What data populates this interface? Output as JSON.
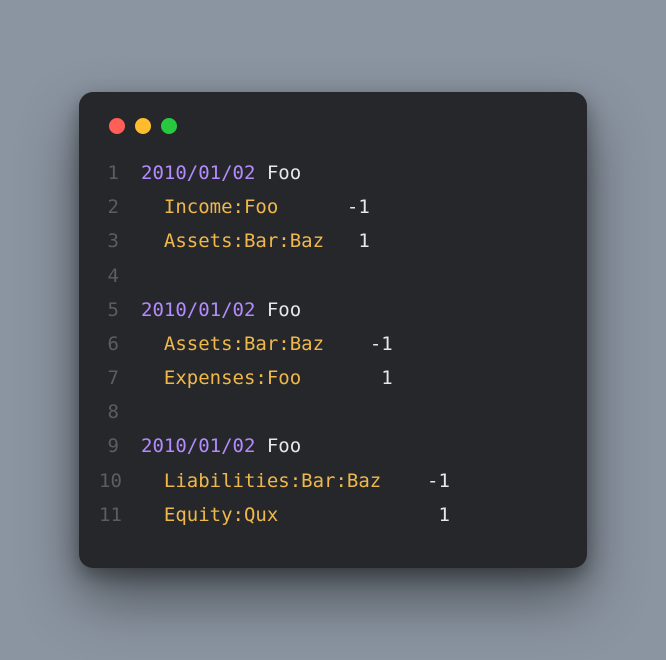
{
  "window": {
    "dots": [
      "red",
      "yellow",
      "green"
    ]
  },
  "lines": [
    {
      "n": "1",
      "type": "header",
      "date": "2010/01/02",
      "desc": "Foo"
    },
    {
      "n": "2",
      "type": "posting",
      "indent": "  ",
      "account": "Income:Foo",
      "spacer": "      ",
      "amount": "-1"
    },
    {
      "n": "3",
      "type": "posting",
      "indent": "  ",
      "account": "Assets:Bar:Baz",
      "spacer": "   ",
      "amount": "1"
    },
    {
      "n": "4",
      "type": "blank"
    },
    {
      "n": "5",
      "type": "header",
      "date": "2010/01/02",
      "desc": "Foo"
    },
    {
      "n": "6",
      "type": "posting",
      "indent": "  ",
      "account": "Assets:Bar:Baz",
      "spacer": "    ",
      "amount": "-1"
    },
    {
      "n": "7",
      "type": "posting",
      "indent": "  ",
      "account": "Expenses:Foo",
      "spacer": "       ",
      "amount": "1"
    },
    {
      "n": "8",
      "type": "blank"
    },
    {
      "n": "9",
      "type": "header",
      "date": "2010/01/02",
      "desc": "Foo"
    },
    {
      "n": "10",
      "type": "posting",
      "indent": "  ",
      "account": "Liabilities:Bar:Baz",
      "spacer": "    ",
      "amount": "-1"
    },
    {
      "n": "11",
      "type": "posting",
      "indent": "  ",
      "account": "Equity:Qux",
      "spacer": "              ",
      "amount": "1"
    }
  ]
}
